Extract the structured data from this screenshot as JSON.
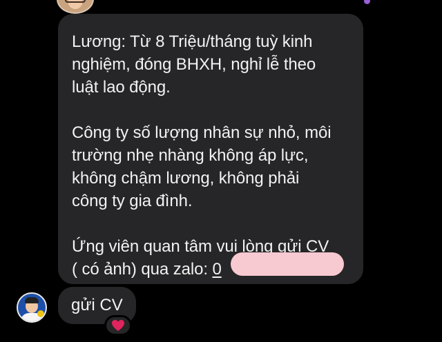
{
  "conversation": {
    "main_message": {
      "paragraph1": [
        "Lương: Từ 8 Triệu/tháng tuỳ kinh",
        "nghiệm, đóng BHXH, nghỉ lễ theo",
        "luật lao động."
      ],
      "paragraph2": [
        "Công ty số lượng nhân sự nhỏ, môi",
        "trường nhẹ nhàng không áp lực,",
        "không chậm lương, không phải",
        "công ty gia đình."
      ],
      "paragraph3_line1": "Ứng viên quan tâm vui lòng gửi CV",
      "paragraph3_line2_prefix": "( có ảnh) qua zalo: ",
      "paragraph3_link_visible": "0"
    },
    "reply_message": {
      "text": "gửi CV"
    },
    "reaction": {
      "icon": "red-heart-icon",
      "color": "#e0245e"
    }
  },
  "colors": {
    "background": "#000000",
    "bubble": "#262628",
    "text": "#f2f2f2",
    "redaction": "#f7c9d0"
  }
}
